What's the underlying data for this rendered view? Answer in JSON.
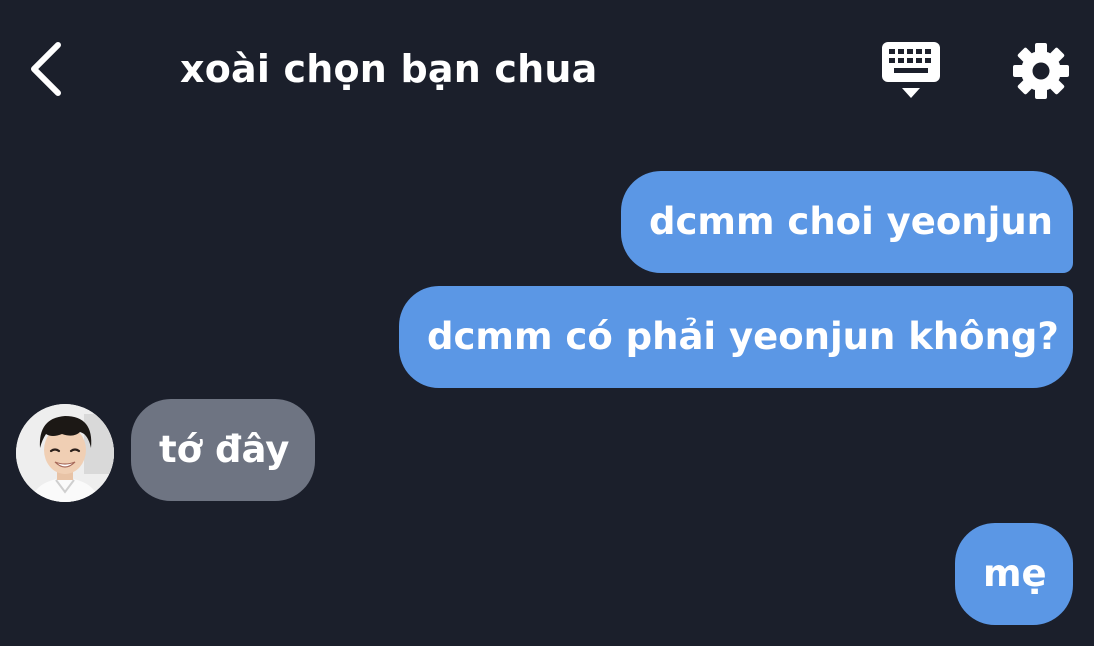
{
  "header": {
    "title": "xoài chọn bạn chua",
    "back_icon": "chevron-left-icon",
    "keyboard_icon": "keyboard-icon",
    "settings_icon": "gear-icon"
  },
  "messages": [
    {
      "sender": "me",
      "text": "dcmm choi yeonjun"
    },
    {
      "sender": "me",
      "text": "dcmm có phải yeonjun không?"
    },
    {
      "sender": "other",
      "text": "tớ đây"
    },
    {
      "sender": "me",
      "text": "mẹ"
    }
  ],
  "colors": {
    "background": "#1b1f2b",
    "outgoing_bubble": "#5b97e5",
    "incoming_bubble": "#6e7482",
    "text": "#ffffff"
  }
}
